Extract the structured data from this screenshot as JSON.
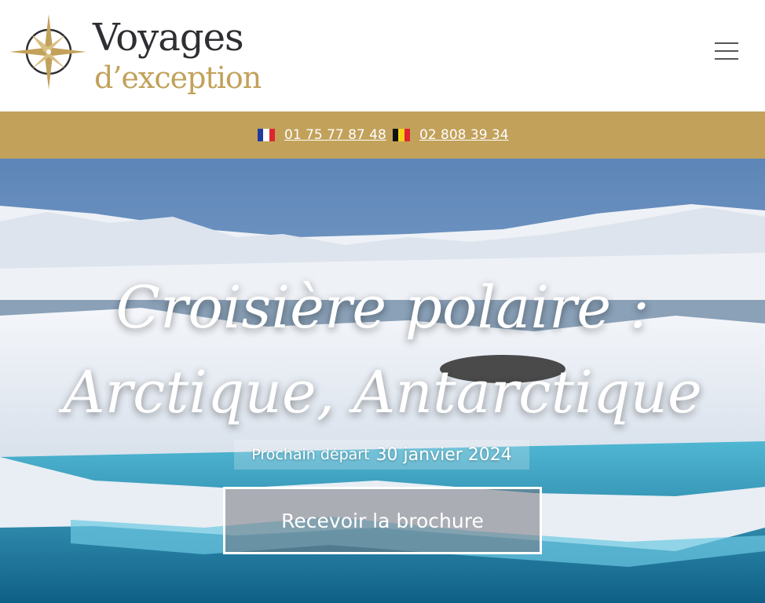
{
  "header": {
    "logo": {
      "line1": "Voyages",
      "line2": "d’exception"
    },
    "menu_icon": "hamburger-menu-icon"
  },
  "contact_bar": {
    "phones": [
      {
        "country": "France",
        "flag": "flag-france-icon",
        "number": "01 75 77 87 48"
      },
      {
        "country": "Belgium",
        "flag": "flag-belgium-icon",
        "number": "02 808 39 34"
      }
    ]
  },
  "hero": {
    "title_line1": "Croisière polaire :",
    "title_line2": "Arctique, Antarctique",
    "next_departure_label": "Prochain départ",
    "next_departure_date": "30 janvier 2024",
    "cta_label": "Recevoir la brochure"
  },
  "colors": {
    "gold": "#c2a15a",
    "logo_dark": "#2e2e33",
    "white": "#ffffff"
  }
}
